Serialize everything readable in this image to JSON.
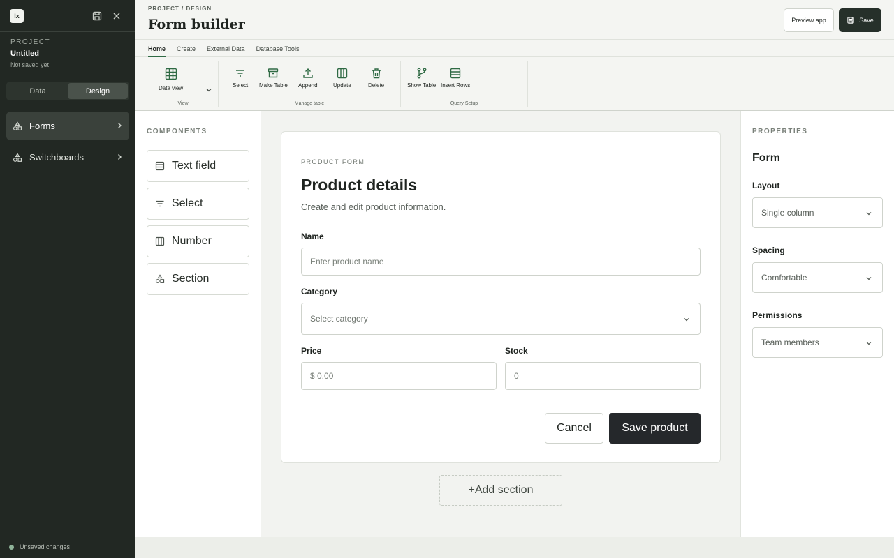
{
  "sidebar": {
    "logo": "lx",
    "project_label": "PROJECT",
    "project_name": "Untitled",
    "project_status": "Not saved yet",
    "toggle": {
      "data": "Data",
      "design": "Design"
    },
    "nav": [
      {
        "label": "Forms",
        "icon": "shapes-icon",
        "active": true
      },
      {
        "label": "Switchboards",
        "icon": "shapes-icon",
        "active": false
      }
    ],
    "footer_status": "Unsaved changes"
  },
  "header": {
    "breadcrumb": "PROJECT / DESIGN",
    "title": "Form builder",
    "preview_label": "Preview app",
    "save_label": "Save"
  },
  "tabs": [
    "Home",
    "Create",
    "External Data",
    "Database Tools"
  ],
  "ribbon": {
    "view": {
      "label": "View",
      "data_view": "Data view"
    },
    "manage": {
      "label": "Manage table",
      "select": "Select",
      "make_table": "Make Table",
      "append": "Append",
      "update": "Update",
      "delete": "Delete"
    },
    "query": {
      "label": "Query Setup",
      "show_table": "Show Table",
      "insert_rows": "Insert Rows"
    }
  },
  "components": {
    "label": "COMPONENTS",
    "items": [
      {
        "label": "Text field",
        "icon": "text-field-icon"
      },
      {
        "label": "Select",
        "icon": "filter-icon"
      },
      {
        "label": "Number",
        "icon": "columns-icon"
      },
      {
        "label": "Section",
        "icon": "shapes-icon"
      }
    ]
  },
  "form": {
    "eyebrow": "PRODUCT FORM",
    "title": "Product details",
    "description": "Create and edit product information.",
    "name_label": "Name",
    "name_placeholder": "Enter product name",
    "category_label": "Category",
    "category_placeholder": "Select category",
    "price_label": "Price",
    "price_placeholder": "$ 0.00",
    "stock_label": "Stock",
    "stock_placeholder": "0",
    "cancel_label": "Cancel",
    "save_label": "Save product",
    "add_section": "+Add section"
  },
  "properties": {
    "label": "PROPERTIES",
    "title": "Form",
    "layout_label": "Layout",
    "layout_value": "Single column",
    "spacing_label": "Spacing",
    "spacing_value": "Comfortable",
    "permissions_label": "Permissions",
    "permissions_value": "Team members"
  },
  "colors": {
    "sidebar_bg": "#222823",
    "accent": "#2f6a44",
    "primary_button": "#25282b"
  }
}
